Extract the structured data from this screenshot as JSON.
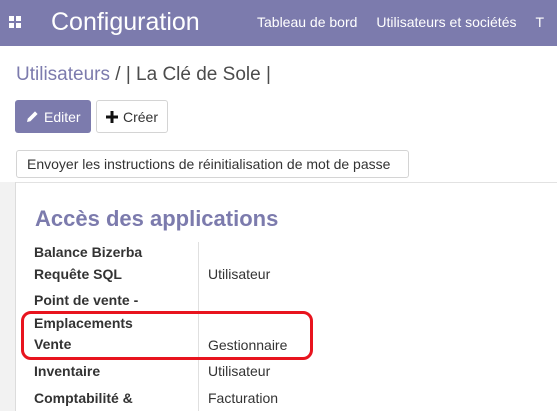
{
  "topbar": {
    "app_title": "Configuration",
    "nav": [
      "Tableau de bord",
      "Utilisateurs et sociétés",
      "T"
    ]
  },
  "breadcrumb": {
    "parent": "Utilisateurs",
    "separator": " / ",
    "current": "| La Clé de Sole |"
  },
  "actions": {
    "edit_label": "Editer",
    "create_label": "Créer",
    "reset_label": "Envoyer les instructions de réinitialisation de mot de passe"
  },
  "section": {
    "title": "Accès des applications",
    "rows": [
      {
        "label": "Balance Bizerba",
        "value": ""
      },
      {
        "label": "Requête SQL",
        "value": "Utilisateur"
      },
      {
        "label_lines": [
          "Point de vente -",
          "Emplacements",
          "Vente"
        ],
        "value": "Gestionnaire"
      },
      {
        "label": "Inventaire",
        "value": "Utilisateur"
      },
      {
        "label": "Comptabilité &",
        "value": "Facturation"
      }
    ]
  },
  "colors": {
    "brand": "#7c7bad",
    "highlight": "#e8141e"
  }
}
